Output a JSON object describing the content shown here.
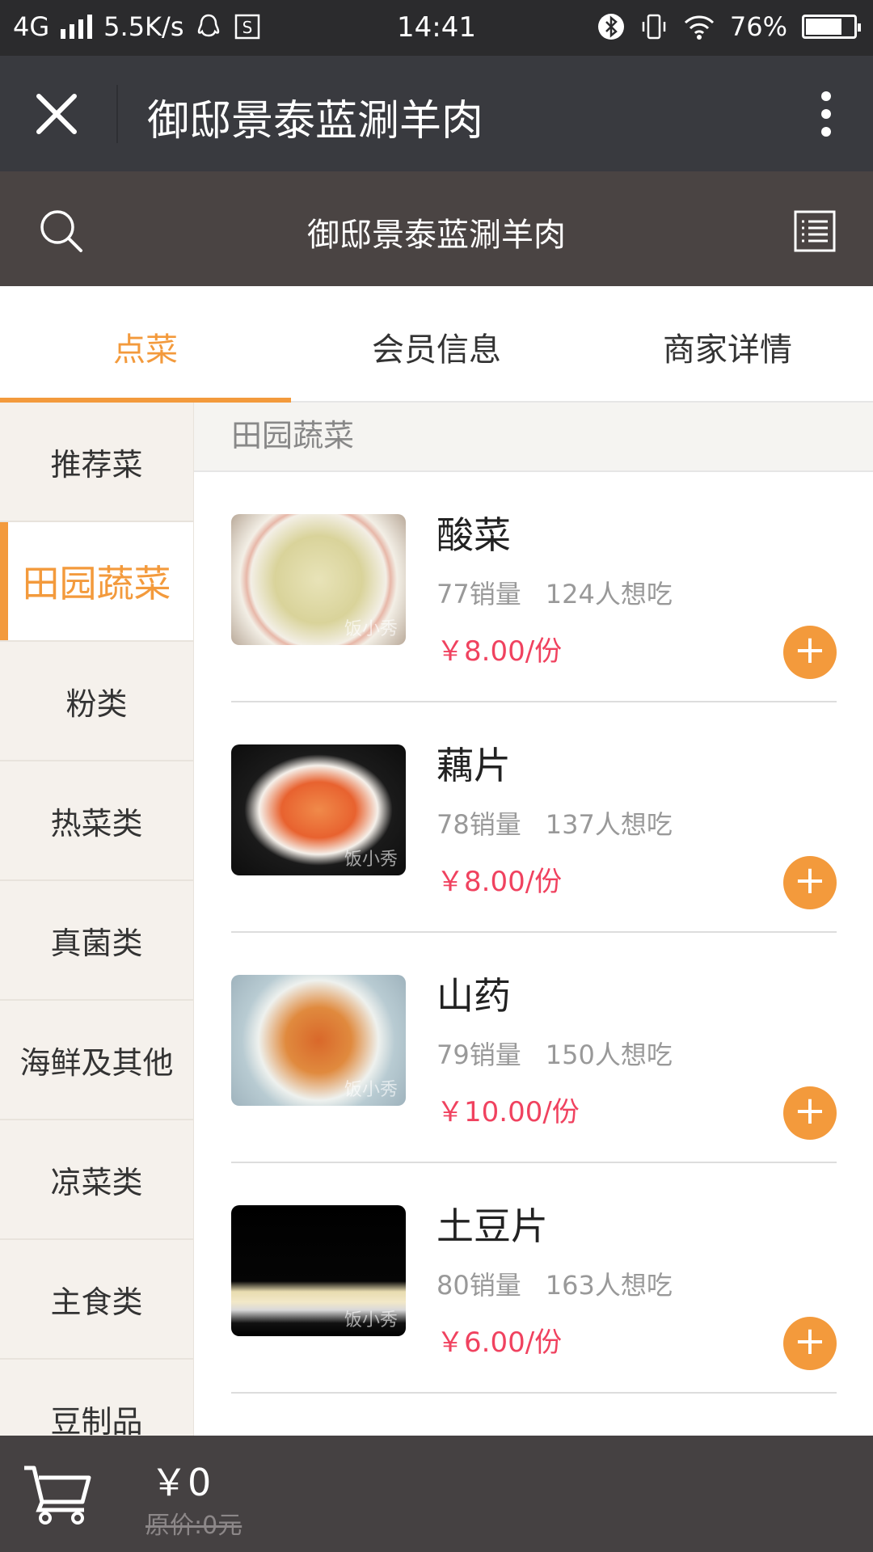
{
  "status_bar": {
    "network": "4G",
    "speed": "5.5K/s",
    "time": "14:41",
    "battery": "76%",
    "battery_level": 0.76
  },
  "nav": {
    "title": "御邸景泰蓝涮羊肉"
  },
  "shop": {
    "title": "御邸景泰蓝涮羊肉"
  },
  "tabs": [
    {
      "label": "点菜",
      "active": true
    },
    {
      "label": "会员信息",
      "active": false
    },
    {
      "label": "商家详情",
      "active": false
    }
  ],
  "categories": [
    {
      "label": "推荐菜"
    },
    {
      "label": "田园蔬菜"
    },
    {
      "label": "粉类"
    },
    {
      "label": "热菜类"
    },
    {
      "label": "真菌类"
    },
    {
      "label": "海鲜及其他"
    },
    {
      "label": "凉菜类"
    },
    {
      "label": "主食类"
    },
    {
      "label": "豆制品"
    }
  ],
  "section_title": "田园蔬菜",
  "items": [
    {
      "name": "酸菜",
      "sales": "77销量",
      "wants": "124人想吃",
      "price": "￥8.00/份"
    },
    {
      "name": "藕片",
      "sales": "78销量",
      "wants": "137人想吃",
      "price": "￥8.00/份"
    },
    {
      "name": "山药",
      "sales": "79销量",
      "wants": "150人想吃",
      "price": "￥10.00/份"
    },
    {
      "name": "土豆片",
      "sales": "80销量",
      "wants": "163人想吃",
      "price": "￥6.00/份"
    }
  ],
  "watermark": "饭小秀",
  "cart": {
    "total": "￥0",
    "original": "原价:0元"
  },
  "colors": {
    "accent": "#f39a3c",
    "price": "#f0425f",
    "nav_bg": "#393a3f",
    "shop_bg": "#4a4443",
    "cart_bg": "#454142"
  }
}
